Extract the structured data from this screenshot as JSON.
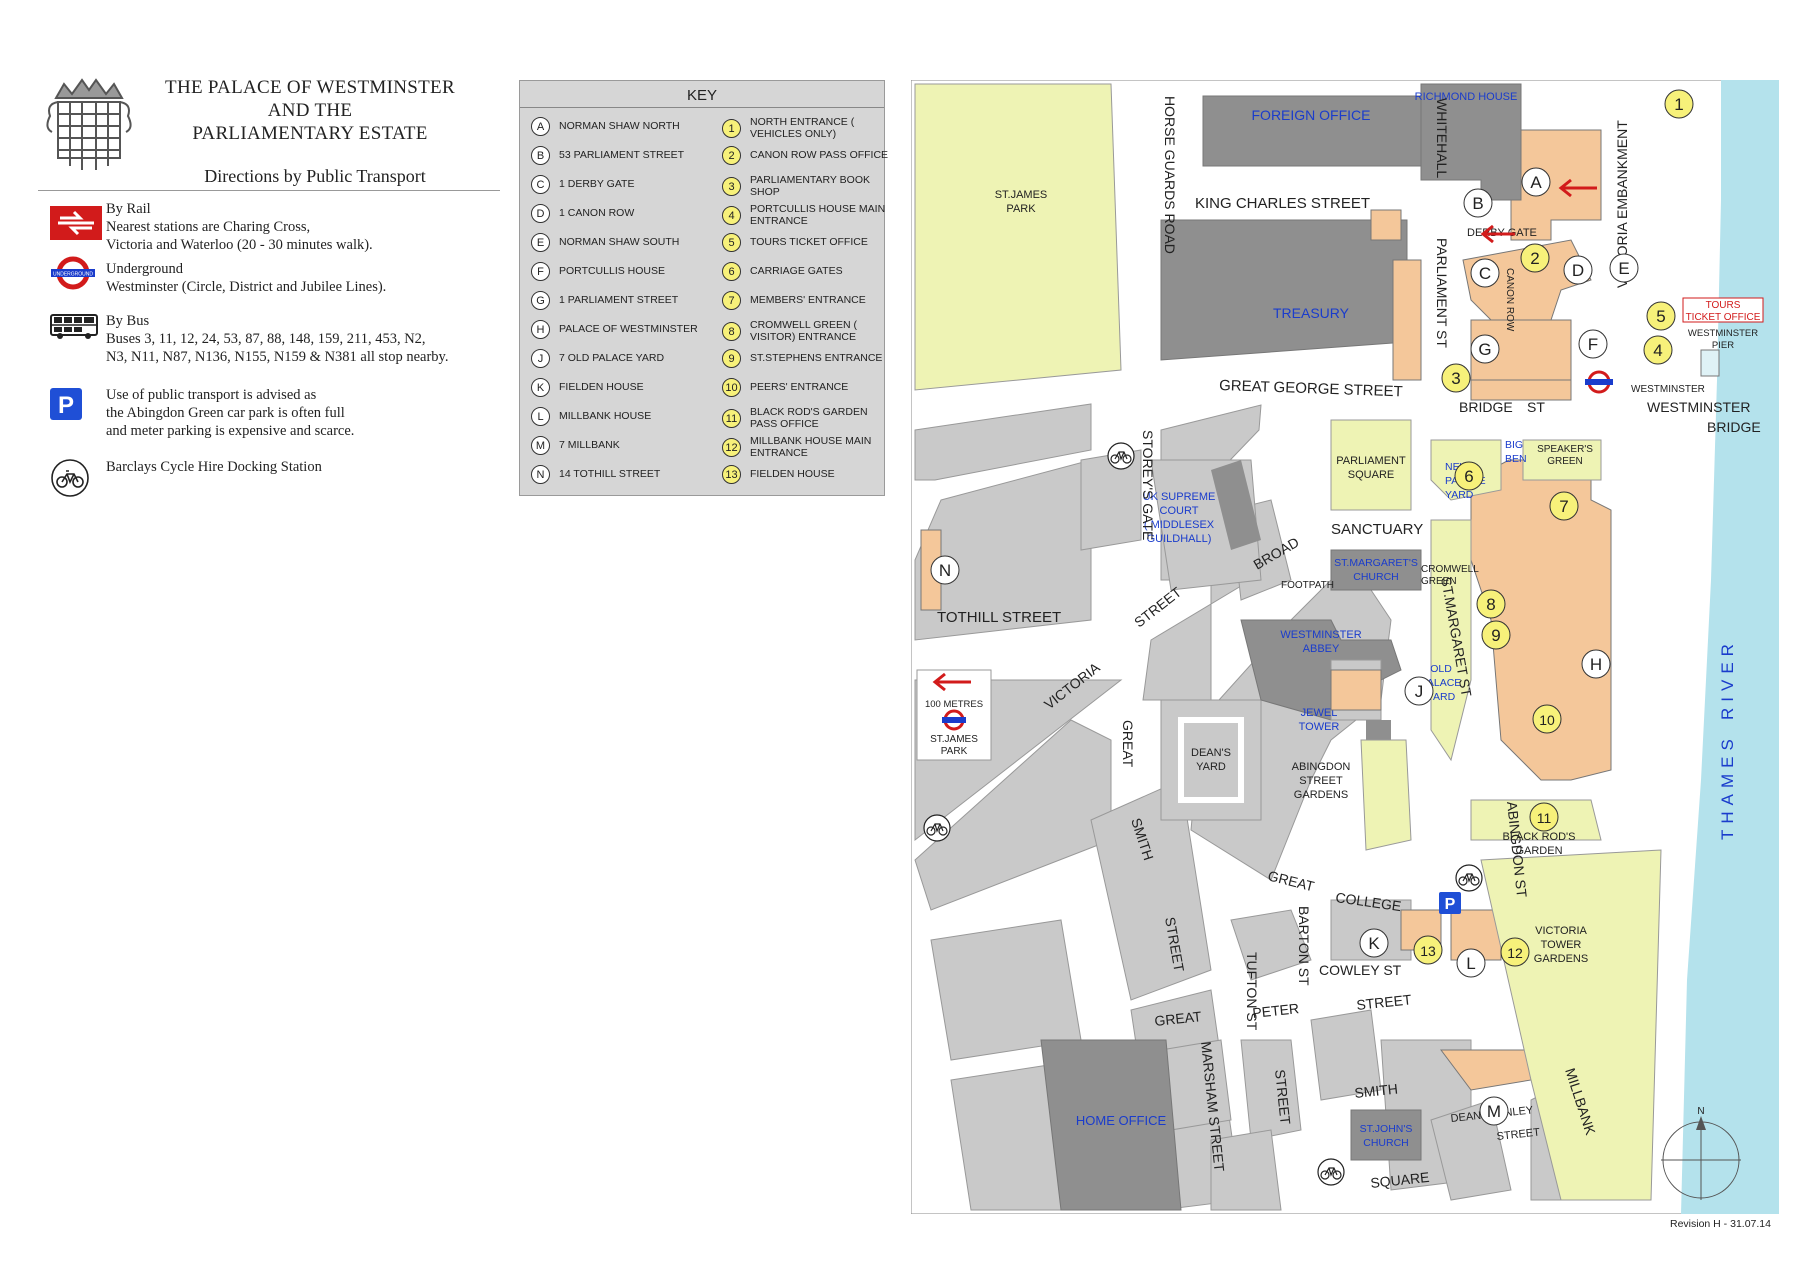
{
  "title_lines": [
    "THE PALACE OF WESTMINSTER",
    "AND THE",
    "PARLIAMENTARY ESTATE"
  ],
  "subtitle": "Directions by Public Transport",
  "transport": {
    "rail": {
      "heading": "By Rail",
      "text1": "Nearest stations are Charing Cross,",
      "text2": "Victoria and Waterloo (20 - 30 minutes walk).",
      "icon": "british-rail-icon"
    },
    "underground": {
      "heading": "Underground",
      "text1": "Westminster (Circle, District and Jubilee Lines).",
      "icon": "underground-roundel-icon",
      "roundel_text": "UNDERGROUND"
    },
    "bus": {
      "heading": "By Bus",
      "text1": "Buses 3, 11, 12, 24, 53, 87, 88, 148, 159, 211, 453, N2,",
      "text2": "N3, N11, N87, N136, N155, N159 & N381 all stop nearby.",
      "icon": "bus-icon"
    },
    "parking": {
      "text1": "Use of public transport is advised as",
      "text2": "the Abingdon Green car park is often full",
      "text3": "and meter parking is expensive and scarce.",
      "icon": "parking-icon",
      "icon_letter": "P"
    },
    "cycle": {
      "text1": "Barclays Cycle Hire Docking Station",
      "icon": "cycle-hire-icon"
    }
  },
  "key": {
    "title": "KEY",
    "letters": [
      {
        "badge": "A",
        "label": "NORMAN SHAW NORTH"
      },
      {
        "badge": "B",
        "label": "53 PARLIAMENT STREET"
      },
      {
        "badge": "C",
        "label": "1 DERBY GATE"
      },
      {
        "badge": "D",
        "label": "1 CANON ROW"
      },
      {
        "badge": "E",
        "label": "NORMAN SHAW SOUTH"
      },
      {
        "badge": "F",
        "label": "PORTCULLIS HOUSE"
      },
      {
        "badge": "G",
        "label": "1 PARLIAMENT STREET"
      },
      {
        "badge": "H",
        "label": "PALACE OF WESTMINSTER"
      },
      {
        "badge": "J",
        "label": "7 OLD PALACE YARD"
      },
      {
        "badge": "K",
        "label": "FIELDEN HOUSE"
      },
      {
        "badge": "L",
        "label": "MILLBANK HOUSE"
      },
      {
        "badge": "M",
        "label": "7 MILLBANK"
      },
      {
        "badge": "N",
        "label": "14 TOTHILL STREET"
      }
    ],
    "numbers": [
      {
        "badge": "1",
        "label": "NORTH ENTRANCE ( VEHICLES ONLY)"
      },
      {
        "badge": "2",
        "label": "CANON ROW PASS OFFICE"
      },
      {
        "badge": "3",
        "label": "PARLIAMENTARY BOOK SHOP"
      },
      {
        "badge": "4",
        "label": "PORTCULLIS HOUSE MAIN ENTRANCE"
      },
      {
        "badge": "5",
        "label": "TOURS TICKET OFFICE"
      },
      {
        "badge": "6",
        "label": "CARRIAGE GATES"
      },
      {
        "badge": "7",
        "label": "MEMBERS' ENTRANCE"
      },
      {
        "badge": "8",
        "label": "CROMWELL GREEN ( VISITOR) ENTRANCE"
      },
      {
        "badge": "9",
        "label": "ST.STEPHENS ENTRANCE"
      },
      {
        "badge": "10",
        "label": "PEERS' ENTRANCE"
      },
      {
        "badge": "11",
        "label": "BLACK ROD'S GARDEN PASS OFFICE"
      },
      {
        "badge": "12",
        "label": "MILLBANK HOUSE MAIN ENTRANCE"
      },
      {
        "badge": "13",
        "label": "FIELDEN HOUSE"
      }
    ]
  },
  "map": {
    "streets": {
      "horse_guards_road": "HORSE GUARDS ROAD",
      "whitehall": "WHITEHALL",
      "king_charles_street": "KING CHARLES STREET",
      "derby_gate": "DERBY GATE",
      "parliament_st": "PARLIAMENT ST",
      "canon_row": "CANON ROW",
      "victoria_embankment": "VICTORIA EMBANKMENT",
      "great_george_street": "GREAT GEORGE STREET",
      "bridge": "BRIDGE",
      "st": "ST",
      "westminster": "WESTMINSTER",
      "bridge2": "BRIDGE",
      "storeys_gate": "STOREY'S GATE",
      "sanctuary": "SANCTUARY",
      "broad": "BROAD",
      "footpath": "FOOTPATH",
      "tothill_street": "TOTHILL STREET",
      "victoria": "VICTORIA",
      "street": "STREET",
      "great_smith": "GREAT",
      "smith": "SMITH",
      "street2": "STREET",
      "st_margaret_st": "ST.MARGARET ST",
      "abingdon_st": "ABINGDON ST",
      "great_college_st": "GREAT",
      "college": "COLLEGE",
      "st2": "ST",
      "tufton_st": "TUFTON ST",
      "barton_st": "BARTON ST",
      "cowley_st": "COWLEY ST",
      "great_peter": "GREAT",
      "peter": "PETER",
      "street3": "STREET",
      "marsham_street": "MARSHAM STREET",
      "street4": "STREET",
      "smith2": "SMITH",
      "square": "SQUARE",
      "dean_stanley": "DEAN STANLEY",
      "street5": "STREET",
      "millbank": "MILLBANK"
    },
    "places": {
      "foreign_office": "FOREIGN OFFICE",
      "richmond_house": "RICHMOND HOUSE",
      "st_james_park_1": "ST.JAMES",
      "st_james_park_2": "PARK",
      "treasury": "TREASURY",
      "parliament_square_1": "PARLIAMENT",
      "parliament_square_2": "SQUARE",
      "uk_supreme_court": [
        "UK SUPREME",
        "COURT",
        "( MIDDLESEX",
        "GUILDHALL)"
      ],
      "st_margarets_church": [
        "ST.MARGARET'S",
        "CHURCH"
      ],
      "westminster_abbey": [
        "WESTMINSTER",
        "ABBEY"
      ],
      "jewel_tower": [
        "JEWEL",
        "TOWER"
      ],
      "deans_yard": [
        "DEAN'S",
        "YARD"
      ],
      "abingdon_gardens": [
        "ABINGDON",
        "STREET",
        "GARDENS"
      ],
      "new_palace_yard": [
        "NEW",
        "PALACE",
        "YARD"
      ],
      "big_ben": [
        "BIG",
        "BEN"
      ],
      "speakers_green": [
        "SPEAKER'S",
        "GREEN"
      ],
      "cromwell_green": [
        "CROMWELL",
        "GREEN"
      ],
      "old_palace_yard": [
        "OLD",
        "PALACE",
        "YARD"
      ],
      "black_rods_garden": [
        "BLACK ROD'S",
        "GARDEN"
      ],
      "victoria_tower_gardens": [
        "VICTORIA",
        "TOWER",
        "GARDENS"
      ],
      "home_office": "HOME OFFICE",
      "st_johns_church": [
        "ST.JOHN'S",
        "CHURCH"
      ],
      "tours_ticket_office": [
        "TOURS",
        "TICKET OFFICE"
      ],
      "westminster_pier": [
        "WESTMINSTER",
        "PIER"
      ],
      "westminster_station": "WESTMINSTER",
      "river": "RIVER",
      "thames": "THAMES",
      "distance": "100 METRES",
      "st_james_station": [
        "ST.JAMES",
        "PARK"
      ],
      "north": "N"
    }
  },
  "revision": "Revision H - 31.07.14",
  "colors": {
    "road": "#ffffff",
    "block": "#c9c9c9",
    "park": "#eef3b4",
    "building": "#f4c79a",
    "river": "#b4e2ec",
    "arrow": "#d21b1b",
    "place_blue": "#1a3ccc",
    "badge_yellow": "#f7f17a"
  }
}
